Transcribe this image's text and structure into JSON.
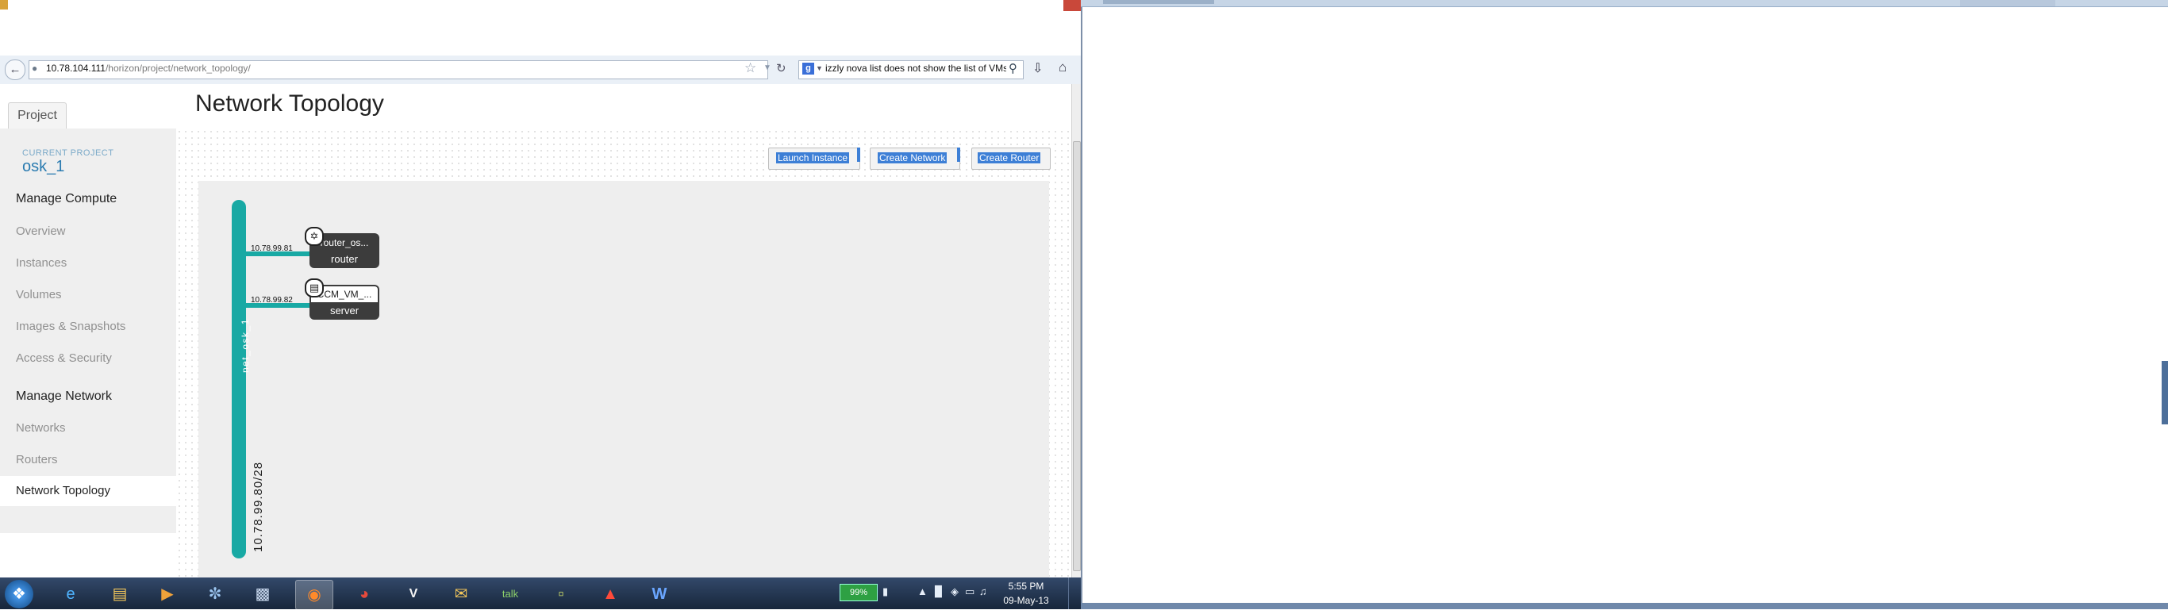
{
  "browser": {
    "url_host": "10.78.104.111",
    "url_path": "/horizon/project/network_topology/",
    "search_text": "izzly nova list does not show the list of VMs",
    "icons": {
      "back": "back-arrow-icon",
      "star": "star-icon",
      "reload": "reload-icon",
      "search_engine": "google-icon",
      "search_go": "magnifier-icon",
      "download": "download-arrow-icon",
      "home": "home-icon"
    }
  },
  "page": {
    "tab_label": "Project",
    "title": "Network Topology"
  },
  "sidebar": {
    "current_project_label": "CURRENT PROJECT",
    "current_project_name": "osk_1",
    "compute_header": "Manage Compute",
    "compute_items": [
      "Overview",
      "Instances",
      "Volumes",
      "Images & Snapshots",
      "Access & Security"
    ],
    "network_header": "Manage Network",
    "network_items": [
      "Networks",
      "Routers",
      "Network Topology"
    ],
    "active_item": "Network Topology"
  },
  "actions": {
    "launch_instance": "Launch Instance",
    "create_network": "Create Network",
    "create_router": "Create Router"
  },
  "topology": {
    "network_name": "net_osk_1",
    "network_cidr": "10.78.99.80/28",
    "network_color": "#18a9a4",
    "router": {
      "ip": "10.78.99.81",
      "name": "router_os...",
      "type": "router"
    },
    "server": {
      "ip": "10.78.99.82",
      "name": "CCM_VM_...",
      "type": "server"
    }
  },
  "taskbar": {
    "battery": "99%",
    "clock_time": "5:55 PM",
    "clock_date": "09-May-13",
    "apps": [
      "internet-explorer-icon",
      "file-explorer-icon",
      "media-player-icon",
      "network-tool-icon",
      "remote-tool-icon",
      "firefox-icon",
      "chrome-icon",
      "vmware-icon",
      "outlook-icon",
      "gtalk-icon",
      "notes-icon",
      "adobe-reader-icon",
      "word-icon"
    ]
  }
}
